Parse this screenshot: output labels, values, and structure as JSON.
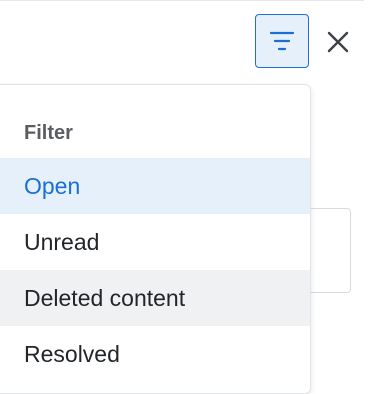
{
  "header": {
    "filter_button_icon": "filter-lines-icon",
    "close_button_icon": "close-x-icon"
  },
  "filter_menu": {
    "heading": "Filter",
    "options": [
      {
        "label": "Open",
        "state": "selected"
      },
      {
        "label": "Unread",
        "state": "default"
      },
      {
        "label": "Deleted content",
        "state": "hovered"
      },
      {
        "label": "Resolved",
        "state": "default"
      }
    ]
  },
  "colors": {
    "accent": "#1a6fd4",
    "selected_background": "#e6f0fb",
    "hover_background": "#f0f1f3",
    "icon_dark": "#3d4046"
  }
}
